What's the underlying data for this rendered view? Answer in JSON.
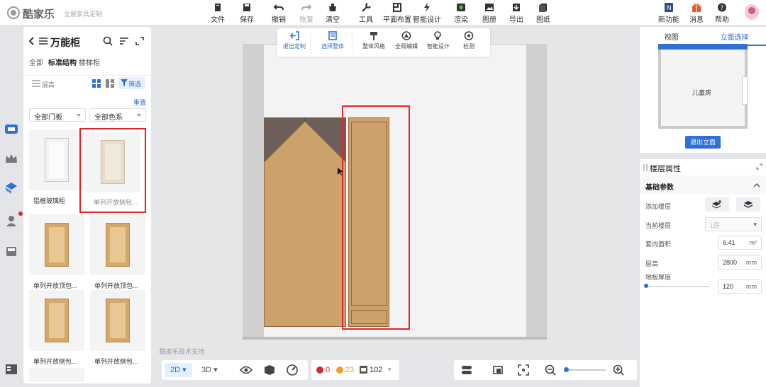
{
  "app": {
    "name": "酷家乐",
    "subtitle": "全屋家具定制"
  },
  "toolbar": {
    "items": [
      {
        "label": "文件",
        "icon": "file-icon"
      },
      {
        "label": "保存",
        "icon": "save-icon"
      },
      {
        "label": "撤销",
        "icon": "undo-icon"
      },
      {
        "label": "恢复",
        "icon": "redo-icon"
      },
      {
        "label": "清空",
        "icon": "clear-icon"
      },
      {
        "label": "工具",
        "icon": "wrench-icon"
      },
      {
        "label": "平面布置",
        "icon": "layout-icon"
      },
      {
        "label": "智能设计",
        "icon": "lightning-icon"
      },
      {
        "label": "渲染",
        "icon": "render-icon"
      },
      {
        "label": "图册",
        "icon": "album-icon"
      },
      {
        "label": "导出",
        "icon": "export-icon"
      },
      {
        "label": "图纸",
        "icon": "drawing-icon"
      }
    ],
    "right": [
      {
        "label": "新功能",
        "icon": "new-feature-icon"
      },
      {
        "label": "消息",
        "icon": "gift-icon"
      },
      {
        "label": "帮助",
        "icon": "help-icon"
      }
    ]
  },
  "library": {
    "title": "万能柜",
    "categories": [
      "全部",
      "标准结构",
      "楼梯柜"
    ],
    "tools": {
      "height": "层高",
      "filter": "筛选"
    },
    "reset": "重置",
    "filters": [
      "全部门板",
      "全部色系"
    ],
    "items": [
      {
        "label": "铝框玻璃柜"
      },
      {
        "label": "单列开放侧包..."
      },
      {
        "label": "单列开放顶包..."
      },
      {
        "label": "单列开放顶包..."
      },
      {
        "label": "单列开放侧包..."
      },
      {
        "label": "单列开放侧包..."
      }
    ]
  },
  "canvas_toolbar": [
    {
      "label": "退出定制",
      "icon": "exit-icon"
    },
    {
      "label": "选择整体",
      "icon": "select-icon"
    },
    {
      "label": "整体风格",
      "icon": "brush-icon"
    },
    {
      "label": "全局编辑",
      "icon": "global-edit-icon"
    },
    {
      "label": "智能设计",
      "icon": "smart-design-icon"
    },
    {
      "label": "检测",
      "icon": "detect-icon"
    }
  ],
  "watermark": "酷家乐技术支持",
  "bottom": {
    "view2d": "2D",
    "view3d": "3D",
    "errors": "0",
    "warnings": "23",
    "count": "102"
  },
  "right_panel": {
    "tabs": [
      "视图",
      "立面选择"
    ],
    "room_label": "儿童房",
    "exit_elevation": "退出立面",
    "title": "楼层属性",
    "section": "基础参数",
    "add_floor": "添加楼层",
    "current_floor": "当前楼层",
    "current_floor_value": "1层",
    "area_label": "套内面积",
    "area_value": "6.41",
    "area_unit": "m²",
    "height_label": "层高",
    "height_value": "2800",
    "height_unit": "mm",
    "thickness_label": "地板厚度",
    "thickness_value": "120",
    "thickness_unit": "mm"
  },
  "colors": {
    "accent": "#2f6fd6",
    "highlight": "#e0262b",
    "wood": "#cda26a",
    "dark_wood": "#6b5f58"
  }
}
